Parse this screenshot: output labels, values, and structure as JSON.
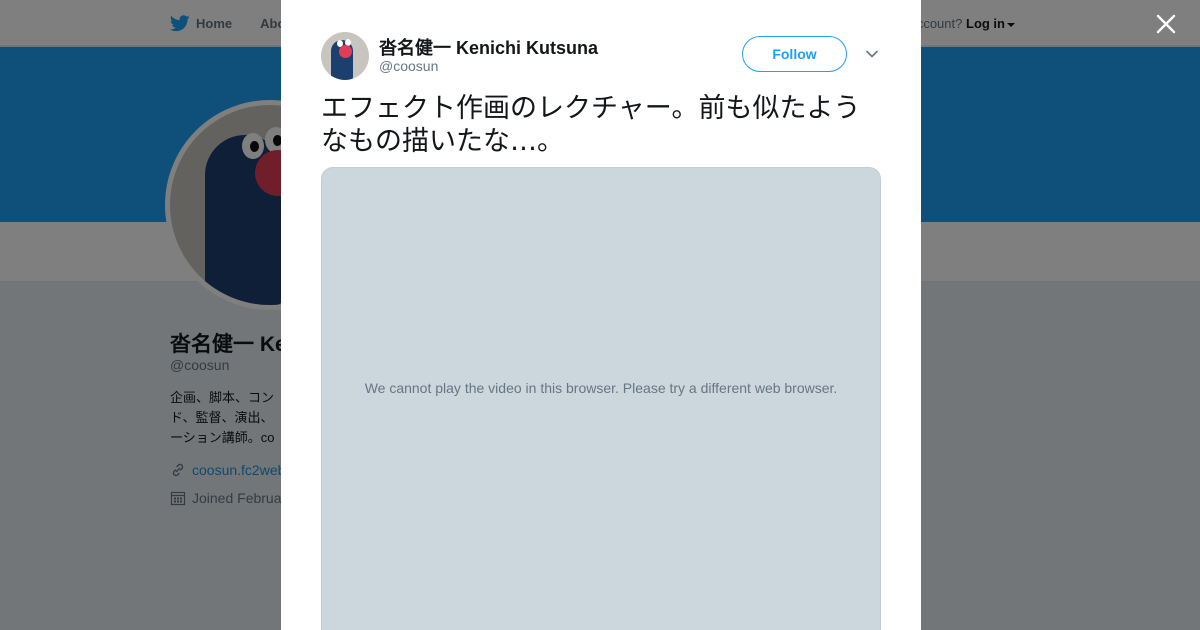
{
  "topbar": {
    "home_label": "Home",
    "about_label": "Abo",
    "account_prompt": "ccount?",
    "login_label": "Log in"
  },
  "profile": {
    "name": "沓名健一 Ke",
    "handle": "@coosun",
    "bio_lines": [
      "企画、脚本、コン",
      "ド、監督、演出、",
      "ーション講師。co"
    ],
    "link": "coosun.fc2web",
    "joined": "Joined Februa"
  },
  "tweet": {
    "author_name": "沓名健一 Kenichi Kutsuna",
    "author_handle": "@coosun",
    "follow_label": "Follow",
    "text": "エフェクト作画のレクチャー。前も似たようなもの描いたな…。",
    "video_message": "We cannot play the video in this browser. Please try a different web browser."
  },
  "colors": {
    "brand": "#1da1f2",
    "overlay": "rgba(0,0,0,0.5)",
    "media_bg": "#ccd6dd"
  },
  "icons": [
    "twitter-bird-icon",
    "close-icon",
    "chevron-down-icon",
    "link-icon",
    "calendar-icon"
  ]
}
